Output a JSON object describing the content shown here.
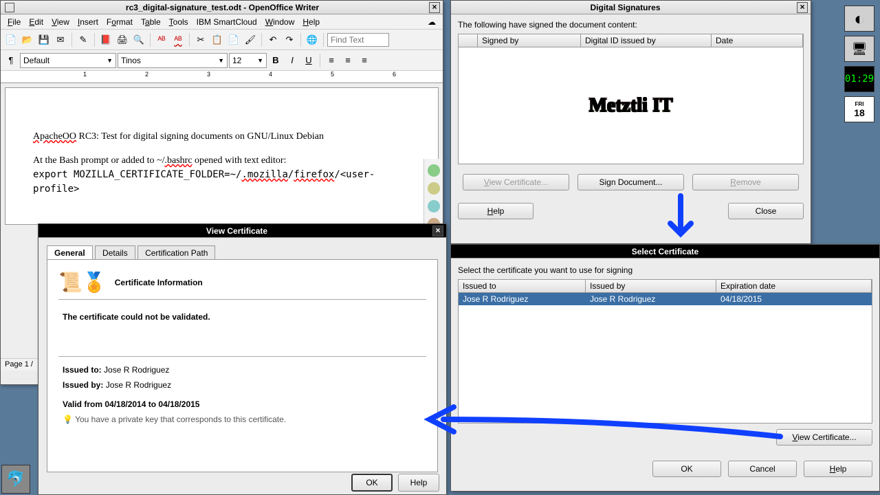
{
  "writer": {
    "title": "rc3_digital-signature_test.odt - OpenOffice Writer",
    "menus": [
      "File",
      "Edit",
      "View",
      "Insert",
      "Format",
      "Table",
      "Tools",
      "IBM SmartCloud",
      "Window",
      "Help"
    ],
    "find_placeholder": "Find Text",
    "style_combo": "Default",
    "font_combo": "Tinos",
    "size_combo": "12",
    "doc_line1_a": "ApacheOO",
    "doc_line1_b": " RC3: Test for digital signing documents on GNU/Linux Debian",
    "doc_line2_a": "At the Bash prompt or added to ~/",
    "doc_line2_b": ".bashrc",
    "doc_line2_c": " opened with text editor:",
    "doc_line3_a": "export MOZILLA_CERTIFICATE_FOLDER=~/",
    "doc_line3_b": ".mozilla",
    "doc_line3_c": "/",
    "doc_line3_d": "firefox",
    "doc_line3_e": "/<user-profile>",
    "status": "Page 1 /"
  },
  "viewcert": {
    "title": "View Certificate",
    "tabs": [
      "General",
      "Details",
      "Certification Path"
    ],
    "heading": "Certificate Information",
    "cannot_validate": "The certificate could not be validated.",
    "issued_to_label": "Issued to:",
    "issued_to": "Jose R Rodriguez",
    "issued_by_label": "Issued by:",
    "issued_by": "Jose R Rodriguez",
    "valid": "Valid from 04/18/2014 to 04/18/2015",
    "privkey": "You have a private key that corresponds to this certificate.",
    "ok": "OK",
    "help": "Help"
  },
  "digsig": {
    "title": "Digital Signatures",
    "intro": "The following have signed the document content:",
    "cols": [
      "Signed by",
      "Digital ID issued by",
      "Date"
    ],
    "logo": "Metztli IT",
    "view_cert_btn": "View Certificate...",
    "sign_btn": "Sign Document...",
    "remove_btn": "Remove",
    "help_btn": "Help",
    "close_btn": "Close"
  },
  "selcert": {
    "title": "Select Certificate",
    "intro": "Select the certificate you want to use for signing",
    "cols": [
      "Issued to",
      "Issued by",
      "Expiration date"
    ],
    "row": {
      "issued_to": "Jose R Rodriguez",
      "issued_by": "Jose R Rodriguez",
      "exp": "04/18/2015"
    },
    "view_cert_btn": "View Certificate...",
    "ok": "OK",
    "cancel": "Cancel",
    "help": "Help"
  },
  "desktop": {
    "time": "01:29",
    "day": "18",
    "dow": "FRI"
  }
}
